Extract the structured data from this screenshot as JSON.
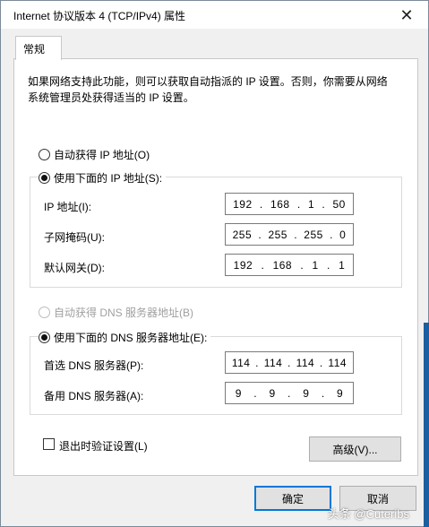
{
  "window": {
    "title": "Internet 协议版本 4 (TCP/IPv4) 属性",
    "close_glyph": "✕"
  },
  "tabs": [
    {
      "label": "常规"
    }
  ],
  "description": "如果网络支持此功能，则可以获取自动指派的 IP 设置。否则，你需要从网络系统管理员处获得适当的 IP 设置。",
  "ip": {
    "auto_label": "自动获得 IP 地址(O)",
    "manual_label": "使用下面的 IP 地址(S):",
    "fields": [
      {
        "label": "IP 地址(I):",
        "octets": [
          "192",
          "168",
          "1",
          "50"
        ]
      },
      {
        "label": "子网掩码(U):",
        "octets": [
          "255",
          "255",
          "255",
          "0"
        ]
      },
      {
        "label": "默认网关(D):",
        "octets": [
          "192",
          "168",
          "1",
          "1"
        ]
      }
    ]
  },
  "dns": {
    "auto_label": "自动获得 DNS 服务器地址(B)",
    "manual_label": "使用下面的 DNS 服务器地址(E):",
    "fields": [
      {
        "label": "首选 DNS 服务器(P):",
        "octets": [
          "114",
          "114",
          "114",
          "114"
        ]
      },
      {
        "label": "备用 DNS 服务器(A):",
        "octets": [
          "9",
          "9",
          "9",
          "9"
        ]
      }
    ]
  },
  "validate_label": "退出时验证设置(L)",
  "advanced_label": "高级(V)...",
  "ok_label": "确定",
  "cancel_label": "取消",
  "watermark": "头条 @Cuteribs",
  "colors": {
    "accent": "#0078d7"
  }
}
